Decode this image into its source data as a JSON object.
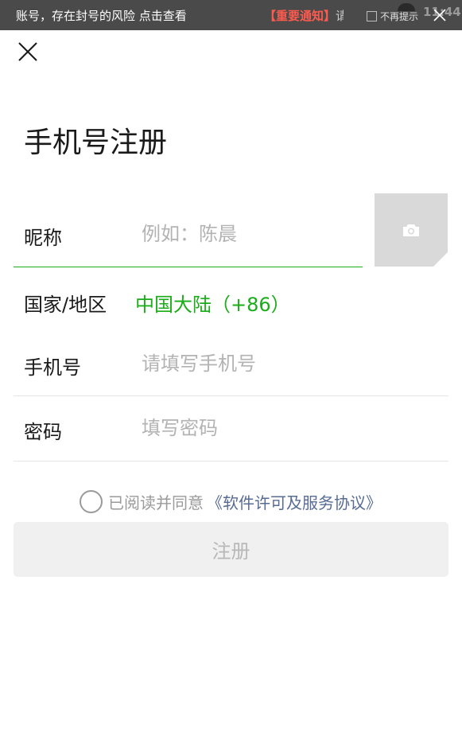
{
  "banner": {
    "message": "账号，存在封号的风险 点击查看",
    "notice": "【重要通知】",
    "notice_tail": "请",
    "dont_remind_label": "不再提示",
    "time": "11:44"
  },
  "page": {
    "title": "手机号注册"
  },
  "form": {
    "nickname": {
      "label": "昵称",
      "placeholder": "例如：陈晨",
      "value": ""
    },
    "country": {
      "label": "国家/地区",
      "value": "中国大陆（+86）"
    },
    "phone": {
      "label": "手机号",
      "placeholder": "请填写手机号",
      "value": ""
    },
    "password": {
      "label": "密码",
      "placeholder": "填写密码",
      "value": ""
    }
  },
  "agreement": {
    "text": "已阅读并同意",
    "link": "《软件许可及服务协议》",
    "checked": false
  },
  "submit": {
    "label": "注册"
  },
  "colors": {
    "accent": "#1aad19",
    "link": "#576b95",
    "banner_bg": "#4a4a4a",
    "notice": "#ff5a4e"
  },
  "icons": {
    "close": "close-icon",
    "camera": "camera-icon"
  }
}
